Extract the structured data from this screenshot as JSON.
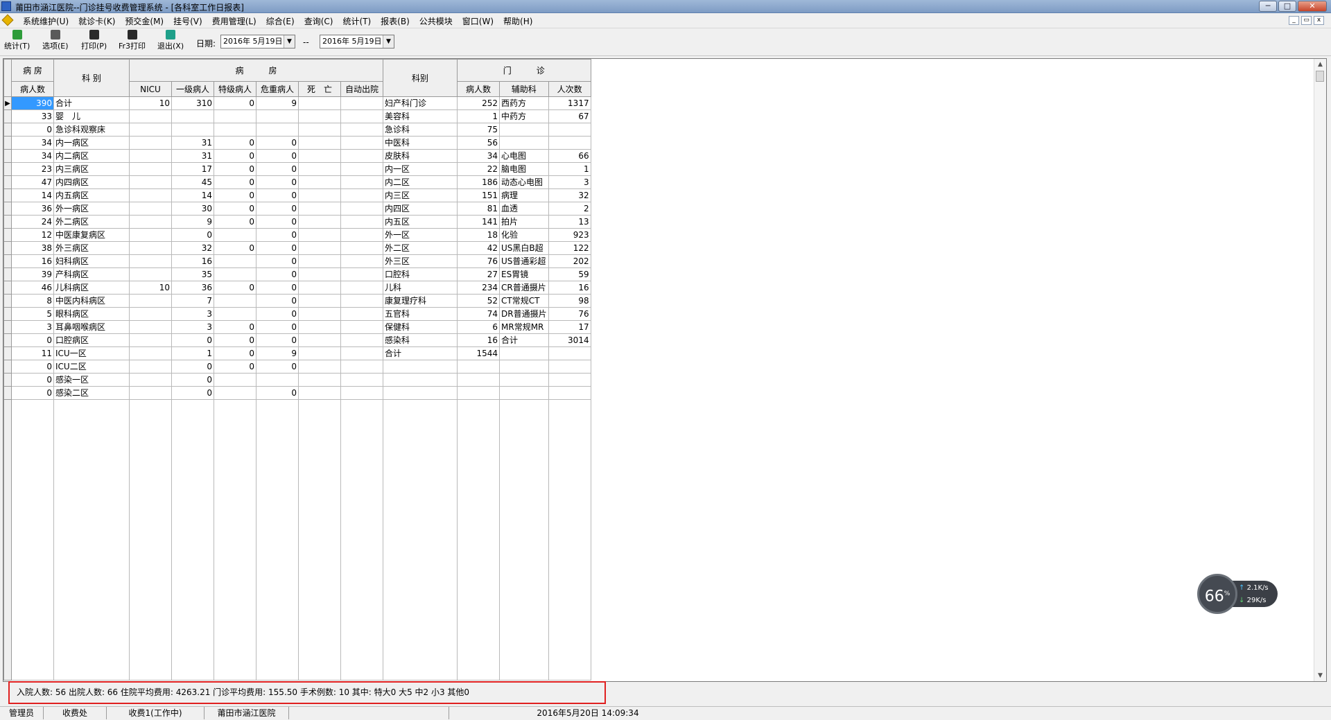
{
  "window": {
    "title": "莆田市涵江医院--门诊挂号收费管理系统 - [各科室工作日报表]",
    "minimize": "─",
    "maximize": "□",
    "close": "✕"
  },
  "menu": [
    "系统维护(U)",
    "就诊卡(K)",
    "预交金(M)",
    "挂号(V)",
    "费用管理(L)",
    "综合(E)",
    "查询(C)",
    "统计(T)",
    "报表(B)",
    "公共模块",
    "窗口(W)",
    "帮助(H)"
  ],
  "mdi_buttons": [
    "_",
    "▭",
    "x"
  ],
  "toolbar": {
    "buttons": [
      {
        "label": "统计(T)",
        "icon": "statistics-icon",
        "color": "#2e9c3a"
      },
      {
        "label": "选项(E)",
        "icon": "options-icon",
        "color": "#5a5a5a"
      },
      {
        "label": "打印(P)",
        "icon": "printer-icon",
        "color": "#2a2a2a"
      },
      {
        "label": "Fr3打印",
        "icon": "printer-icon",
        "color": "#2a2a2a"
      },
      {
        "label": "退出(X)",
        "icon": "exit-icon",
        "color": "#1fa08a"
      }
    ],
    "date_label": "日期:",
    "date_from": "2016年 5月19日",
    "date_sep": "--",
    "date_to": "2016年 5月19日"
  },
  "grid": {
    "headers": {
      "bingfang_top": "病 房",
      "bingrenshu": "病人数",
      "keibie": "科 别",
      "bingfang_group": "病　　　房",
      "nicu": "NICU",
      "yiji": "一级病人",
      "teji": "特级病人",
      "weizhong": "危重病人",
      "siwang": "死　亡",
      "zidong": "自动出院",
      "keibie2": "科别",
      "menzhen_group": "门　　　诊",
      "mz_bingrenshu": "病人数",
      "fuzhuke": "辅助科",
      "renci": "人次数"
    },
    "rows": [
      [
        "390",
        "合计",
        "10",
        "310",
        "0",
        "9",
        "",
        "",
        "妇产科门诊",
        "252",
        "西药方",
        "1317"
      ],
      [
        "33",
        "婴　儿",
        "",
        "",
        "",
        "",
        "",
        "",
        "美容科",
        "1",
        "中药方",
        "67"
      ],
      [
        "0",
        "急诊科观察床",
        "",
        "",
        "",
        "",
        "",
        "",
        "急诊科",
        "75",
        "",
        ""
      ],
      [
        "34",
        "内一病区",
        "",
        "31",
        "0",
        "0",
        "",
        "",
        "中医科",
        "56",
        "",
        ""
      ],
      [
        "34",
        "内二病区",
        "",
        "31",
        "0",
        "0",
        "",
        "",
        "皮肤科",
        "34",
        "心电图",
        "66"
      ],
      [
        "23",
        "内三病区",
        "",
        "17",
        "0",
        "0",
        "",
        "",
        "内一区",
        "22",
        "脑电图",
        "1"
      ],
      [
        "47",
        "内四病区",
        "",
        "45",
        "0",
        "0",
        "",
        "",
        "内二区",
        "186",
        "动态心电图",
        "3"
      ],
      [
        "14",
        "内五病区",
        "",
        "14",
        "0",
        "0",
        "",
        "",
        "内三区",
        "151",
        "病理",
        "32"
      ],
      [
        "36",
        "外一病区",
        "",
        "30",
        "0",
        "0",
        "",
        "",
        "内四区",
        "81",
        "血透",
        "2"
      ],
      [
        "24",
        "外二病区",
        "",
        "9",
        "0",
        "0",
        "",
        "",
        "内五区",
        "141",
        "拍片",
        "13"
      ],
      [
        "12",
        "中医康复病区",
        "",
        "0",
        "",
        "0",
        "",
        "",
        "外一区",
        "18",
        "化验",
        "923"
      ],
      [
        "38",
        "外三病区",
        "",
        "32",
        "0",
        "0",
        "",
        "",
        "外二区",
        "42",
        "US黑白B超",
        "122"
      ],
      [
        "16",
        "妇科病区",
        "",
        "16",
        "",
        "0",
        "",
        "",
        "外三区",
        "76",
        "US普通彩超",
        "202"
      ],
      [
        "39",
        "产科病区",
        "",
        "35",
        "",
        "0",
        "",
        "",
        "口腔科",
        "27",
        "ES胃镜",
        "59"
      ],
      [
        "46",
        "儿科病区",
        "10",
        "36",
        "0",
        "0",
        "",
        "",
        "儿科",
        "234",
        "CR普通摄片",
        "16"
      ],
      [
        "8",
        "中医内科病区",
        "",
        "7",
        "",
        "0",
        "",
        "",
        "康复理疗科",
        "52",
        "CT常规CT",
        "98"
      ],
      [
        "5",
        "眼科病区",
        "",
        "3",
        "",
        "0",
        "",
        "",
        "五官科",
        "74",
        "DR普通摄片",
        "76"
      ],
      [
        "3",
        "耳鼻咽喉病区",
        "",
        "3",
        "0",
        "0",
        "",
        "",
        "保健科",
        "6",
        "MR常规MR",
        "17"
      ],
      [
        "0",
        "口腔病区",
        "",
        "0",
        "0",
        "0",
        "",
        "",
        "感染科",
        "16",
        "合计",
        "3014"
      ],
      [
        "11",
        "ICU一区",
        "",
        "1",
        "0",
        "9",
        "",
        "",
        "合计",
        "1544",
        "",
        ""
      ],
      [
        "0",
        "ICU二区",
        "",
        "0",
        "0",
        "0",
        "",
        "",
        "",
        "",
        "",
        ""
      ],
      [
        "0",
        "感染一区",
        "",
        "0",
        "",
        "",
        "",
        "",
        "",
        "",
        "",
        ""
      ],
      [
        "0",
        "感染二区",
        "",
        "0",
        "",
        "0",
        "",
        "",
        "",
        "",
        "",
        ""
      ]
    ],
    "row_indicator": "▶"
  },
  "summary": "入院人数: 56 出院人数: 66 住院平均费用: 4263.21 门诊平均费用: 155.50 手术例数: 10 其中: 特大0 大5 中2 小3 其他0",
  "statusbar": [
    "管理员",
    "收费处",
    "收费1(工作中)",
    "莆田市涵江医院",
    "",
    "2016年5月20日 14:09:34"
  ],
  "net_widget": {
    "percent": "66",
    "percent_unit": "%",
    "up": "2.1",
    "up_unit": "K/s",
    "down": "29",
    "down_unit": "K/s",
    "up_arrow": "↑",
    "down_arrow": "↓"
  },
  "colors": {
    "selection": "#3399ff",
    "summary_border": "#e02020",
    "titlebar": "#8aa6cc"
  }
}
